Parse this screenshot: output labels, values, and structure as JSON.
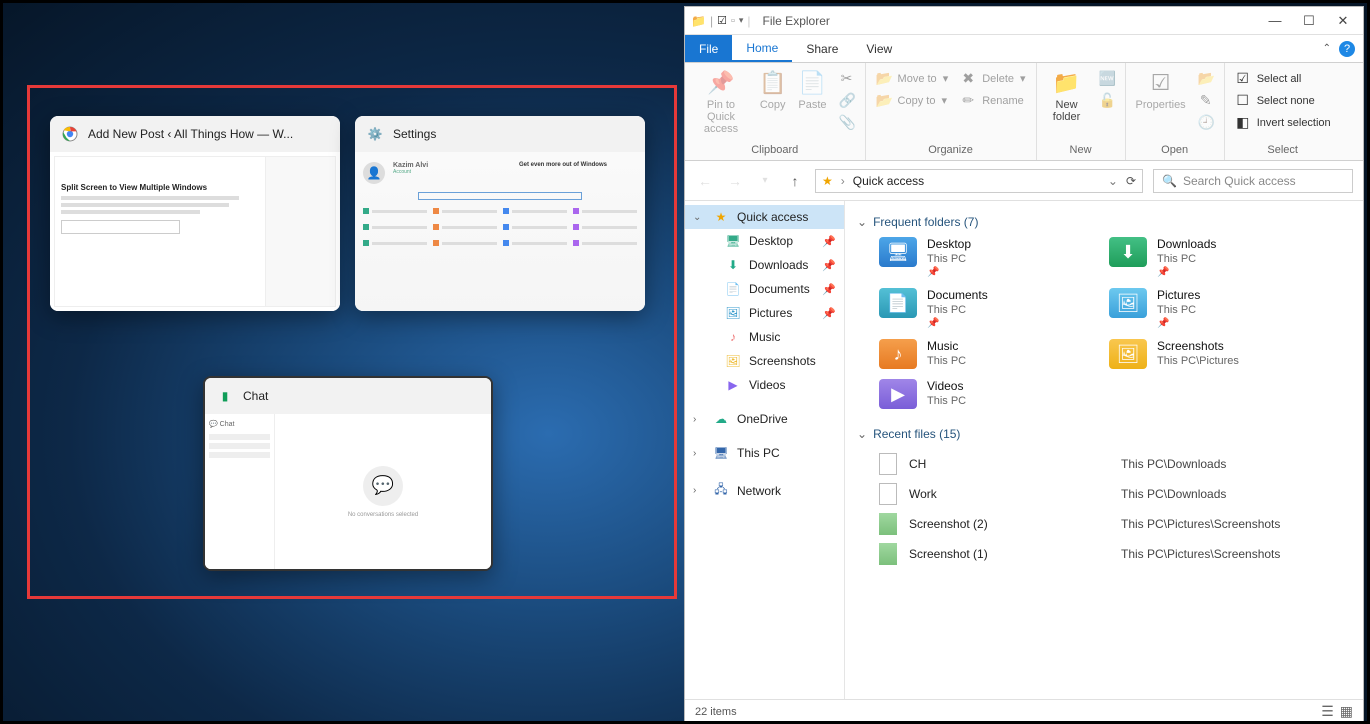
{
  "snap": {
    "thumbs": {
      "chrome": {
        "title": "Add New Post ‹ All Things How — W...",
        "body_heading": "Split Screen to View Multiple Windows"
      },
      "settings": {
        "title": "Settings",
        "user_name": "Kazim Alvi",
        "subtitle": "Get even more out of Windows"
      },
      "chat": {
        "title": "Chat",
        "sidebar_label": "Chat",
        "empty_text": "No conversations selected"
      }
    }
  },
  "fe": {
    "title": "File Explorer",
    "tabs": {
      "file": "File",
      "home": "Home",
      "share": "Share",
      "view": "View"
    },
    "ribbon": {
      "clipboard": {
        "label": "Clipboard",
        "pin": "Pin to Quick access",
        "copy": "Copy",
        "paste": "Paste"
      },
      "organize": {
        "label": "Organize",
        "moveto": "Move to",
        "copyto": "Copy to",
        "delete": "Delete",
        "rename": "Rename"
      },
      "new": {
        "label": "New",
        "newfolder": "New folder"
      },
      "open": {
        "label": "Open",
        "properties": "Properties"
      },
      "select": {
        "label": "Select",
        "all": "Select all",
        "none": "Select none",
        "invert": "Invert selection"
      }
    },
    "address": {
      "location": "Quick access",
      "search_placeholder": "Search Quick access"
    },
    "nav": {
      "quick": "Quick access",
      "items_pinned": [
        "Desktop",
        "Downloads",
        "Documents",
        "Pictures",
        "Music",
        "Screenshots",
        "Videos"
      ],
      "onedrive": "OneDrive",
      "thispc": "This PC",
      "network": "Network"
    },
    "freq": {
      "header": "Frequent folders (7)",
      "items": [
        {
          "name": "Desktop",
          "sub": "This PC",
          "pin": true,
          "c": "fc-blue",
          "g": "🖥"
        },
        {
          "name": "Downloads",
          "sub": "This PC",
          "pin": true,
          "c": "fc-green",
          "g": "⬇"
        },
        {
          "name": "Documents",
          "sub": "This PC",
          "pin": true,
          "c": "fc-teal",
          "g": "📄"
        },
        {
          "name": "Pictures",
          "sub": "This PC",
          "pin": true,
          "c": "fc-cyan",
          "g": "🖼"
        },
        {
          "name": "Music",
          "sub": "This PC",
          "pin": false,
          "c": "fc-orange",
          "g": "♪"
        },
        {
          "name": "Screenshots",
          "sub": "This PC\\Pictures",
          "pin": false,
          "c": "fc-yellow",
          "g": "🖼"
        },
        {
          "name": "Videos",
          "sub": "This PC",
          "pin": false,
          "c": "fc-purple",
          "g": "▶"
        }
      ]
    },
    "recent": {
      "header": "Recent files (15)",
      "items": [
        {
          "name": "CH",
          "loc": "This PC\\Downloads",
          "pic": false
        },
        {
          "name": "Work",
          "loc": "This PC\\Downloads",
          "pic": false
        },
        {
          "name": "Screenshot (2)",
          "loc": "This PC\\Pictures\\Screenshots",
          "pic": true
        },
        {
          "name": "Screenshot (1)",
          "loc": "This PC\\Pictures\\Screenshots",
          "pic": true
        }
      ]
    },
    "status": {
      "count": "22 items"
    }
  }
}
